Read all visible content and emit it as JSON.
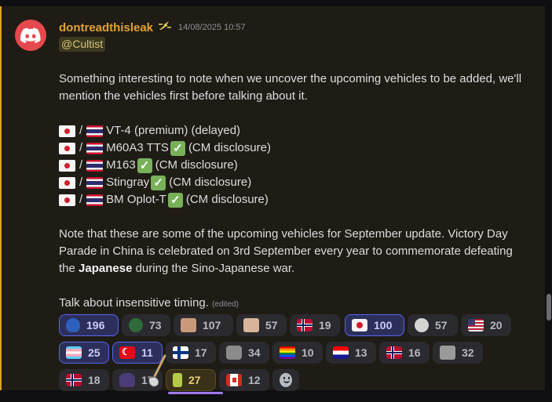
{
  "message": {
    "username": "dontreadthisleak",
    "badge_icon": "lightning-badge-icon",
    "timestamp": "14/08/2025 10:57",
    "mention": "@Cultist",
    "intro": "Something interesting to note when we uncover the upcoming vehicles to be added, we'll mention the vehicles first before talking about it.",
    "slash": "/",
    "vehicles": [
      {
        "name": "VT-4 (premium) (delayed)",
        "check": false,
        "note": ""
      },
      {
        "name": "M60A3 TTS",
        "check": true,
        "note": "(CM disclosure)"
      },
      {
        "name": "M163",
        "check": true,
        "note": "(CM disclosure)"
      },
      {
        "name": "Stingray",
        "check": true,
        "note": "(CM disclosure)"
      },
      {
        "name": "BM Oplot-T",
        "check": true,
        "note": "(CM disclosure)"
      }
    ],
    "note_part1": "Note that these are some of the upcoming vehicles for September update. Victory Day Parade in China is celebrated on 3rd September every year to commemorate defeating the ",
    "note_bold": "Japanese",
    "note_part2": " during the Sino-Japanese war.",
    "closing": "Talk about insensitive timing.",
    "edited": "(edited)"
  },
  "reactions": [
    {
      "emoji": "blue-blob-emoji",
      "count": "196",
      "active": true
    },
    {
      "emoji": "pepe-emoji",
      "count": "73",
      "active": false
    },
    {
      "emoji": "face-emoji",
      "count": "107",
      "active": false
    },
    {
      "emoji": "face2-emoji",
      "count": "57",
      "active": false
    },
    {
      "emoji": "norway-flag-emoji",
      "count": "19",
      "active": false
    },
    {
      "emoji": "japan-flag-emoji",
      "count": "100",
      "active": true
    },
    {
      "emoji": "skull-emoji",
      "count": "57",
      "active": false
    },
    {
      "emoji": "us-flag-emoji",
      "count": "20",
      "active": false
    },
    {
      "emoji": "transgender-flag-emoji",
      "count": "25",
      "active": true
    },
    {
      "emoji": "turkey-flag-emoji",
      "count": "11",
      "active": true
    },
    {
      "emoji": "finland-flag-emoji",
      "count": "17",
      "active": false
    },
    {
      "emoji": "cat-emoji",
      "count": "34",
      "active": false
    },
    {
      "emoji": "rainbow-flag-emoji",
      "count": "10",
      "active": false
    },
    {
      "emoji": "croatia-flag-emoji",
      "count": "13",
      "active": false
    },
    {
      "emoji": "norway-flag-emoji",
      "count": "16",
      "active": false
    },
    {
      "emoji": "dog-emoji",
      "count": "32",
      "active": false
    },
    {
      "emoji": "norway-flag-emoji",
      "count": "18",
      "active": false
    },
    {
      "emoji": "witch-emoji",
      "count": "17",
      "active": false
    },
    {
      "emoji": "bottle-emoji",
      "count": "27",
      "active": false,
      "hover": true
    },
    {
      "emoji": "canada-flag-emoji",
      "count": "12",
      "active": false
    }
  ],
  "colors": {
    "accent_border": "#e0a325",
    "username": "#e3a233",
    "active_reaction": "#5865f2",
    "avatar": "#e5484d"
  }
}
